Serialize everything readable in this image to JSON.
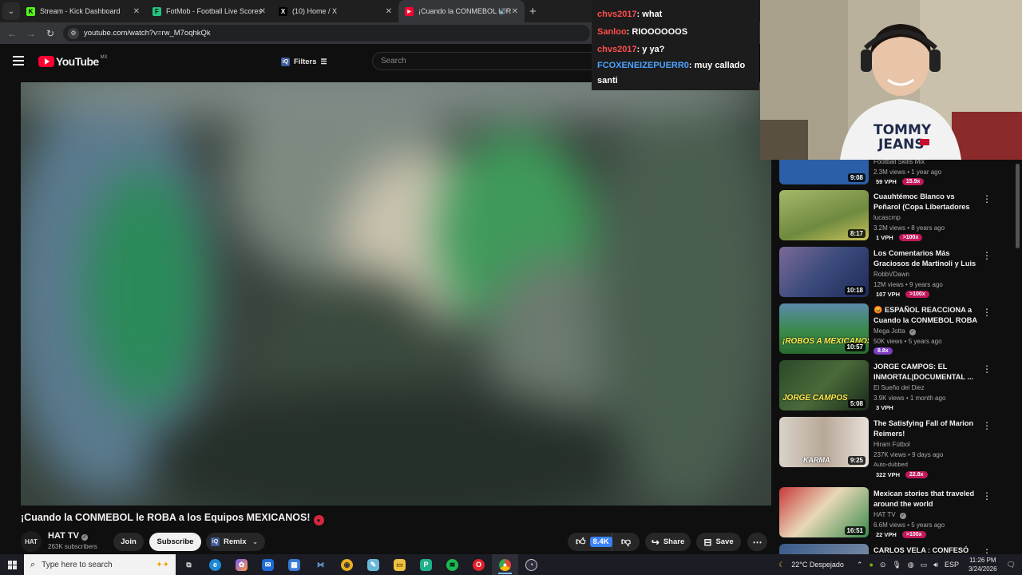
{
  "browser": {
    "tabs": [
      {
        "title": "Stream - Kick Dashboard",
        "icon": "K",
        "color": "#53fc18",
        "active": false
      },
      {
        "title": "FotMob - Football Live Scores",
        "icon": "F",
        "color": "#26c281",
        "active": false
      },
      {
        "title": "(10) Home / X",
        "icon": "X",
        "color": "#222222",
        "active": false
      },
      {
        "title": "¡Cuando la CONMEBOL le R",
        "icon": "▶",
        "color": "#ff0033",
        "active": true
      }
    ],
    "url": "youtube.com/watch?v=rw_M7oqhkQk"
  },
  "youtube": {
    "logo_text": "YouTube",
    "region": "MX",
    "filters_label": "Filters",
    "search_placeholder": "Search"
  },
  "video": {
    "title": "¡Cuando la CONMEBOL le ROBA a los Equipos MEXICANOS!",
    "channel": "HAT TV",
    "subscribers": "263K subscribers",
    "join_label": "Join",
    "subscribe_label": "Subscribe",
    "remix_label": "Remix",
    "like_count": "8.4K",
    "share_label": "Share",
    "save_label": "Save"
  },
  "chat": [
    {
      "user": "chvs2017",
      "text": ": what",
      "color": "#ff4d4d"
    },
    {
      "user": "Sanloo",
      "text": ": RIOOOOOOS",
      "color": "#ff4d4d"
    },
    {
      "user": "chvs2017",
      "text": ": y ya?",
      "color": "#ff4d4d"
    },
    {
      "user": "FCOXENEIZEPUERR0",
      "text": ": muy callado santi",
      "color": "#4da3ff"
    }
  ],
  "recommendations": [
    {
      "title": "",
      "channel": "Football Skills Mix",
      "meta": "2.3M views • 1 year ago",
      "duration": "9:08",
      "vph": "59 VPH",
      "ratio": "15.9x",
      "thumb": "#2c5fa8"
    },
    {
      "title": "Cuauhtémoc Blanco vs Peñarol (Copa Libertadores 2004)",
      "channel": "lucascmp",
      "meta": "3.2M views • 8 years ago",
      "duration": "8:17",
      "vph": "1 VPH",
      "ratio": ">100x",
      "thumb": "#8fa85a"
    },
    {
      "title": "Los Comentarios Más Graciosos de Martinoli y Luis ...",
      "channel": "RobbVDawn",
      "meta": "12M views • 9 years ago",
      "duration": "10:18",
      "vph": "107 VPH",
      "ratio": ">100x",
      "thumb": "#6a5a8a"
    },
    {
      "title": "😡 ESPAÑOL REACCIONA a Cuando la CONMEBOL ROBA ...",
      "channel": "Mega Jotta",
      "meta": "50K views • 5 years ago",
      "duration": "10:57",
      "vph": "",
      "ratio": "8.8x",
      "thumb": "#3a8a4a",
      "caption": "¡ROBOS A MEXICANOS!"
    },
    {
      "title": "JORGE CAMPOS: EL INMORTAL|DOCUMENTAL ...",
      "channel": "El Sueño del Diez",
      "meta": "3.9K views • 1 month ago",
      "duration": "5:08",
      "vph": "3 VPH",
      "ratio": "",
      "thumb": "#2a4a2a",
      "caption": "JORGE CAMPOS"
    },
    {
      "title": "The Satisfying Fall of Marion Reimers!",
      "channel": "Hiram Fútbol",
      "meta": "237K views • 9 days ago",
      "duration": "9:25",
      "vph": "322 VPH",
      "ratio": "22.8x",
      "thumb": "#c9c2b8",
      "dubbed": "Auto-dubbed",
      "caption": "KARMA"
    },
    {
      "title": "Mexican stories that traveled around the world",
      "channel": "HAT TV",
      "meta": "6.6M views • 5 years ago",
      "duration": "16:51",
      "vph": "22 VPH",
      "ratio": ">100x",
      "thumb": "#a83a3a"
    },
    {
      "title": "CARLOS VELA : CONFESÓ POR",
      "channel": "",
      "meta": "",
      "duration": "",
      "vph": "",
      "ratio": "",
      "thumb": "#3a5a8a"
    }
  ],
  "taskbar": {
    "search_placeholder": "Type here to search",
    "weather": "22°C  Despejado",
    "lang": "ESP",
    "time": "11:26 PM",
    "date": "3/24/2026"
  }
}
